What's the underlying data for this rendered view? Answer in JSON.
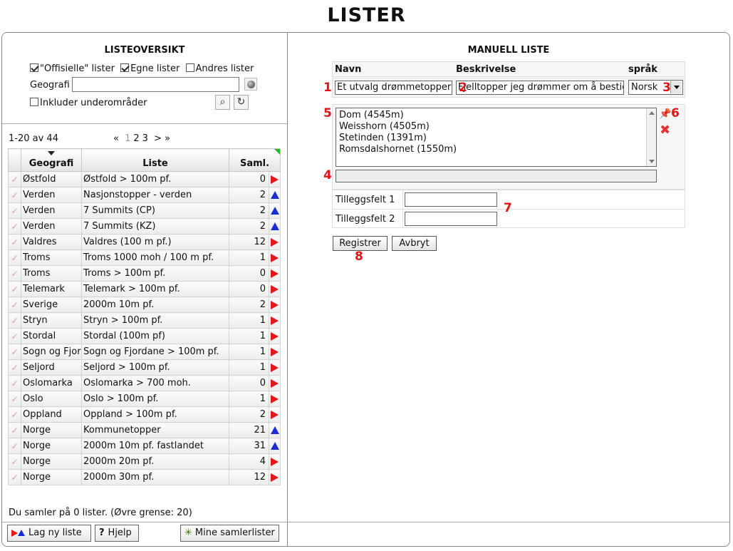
{
  "page": {
    "title": "LISTER"
  },
  "left": {
    "title": "LISTEOVERSIKT",
    "filters": {
      "offisielle": {
        "label": "\"Offisielle\" lister",
        "checked": true
      },
      "egne": {
        "label": "Egne lister",
        "checked": true
      },
      "andres": {
        "label": "Andres lister",
        "checked": false
      }
    },
    "geo_label": "Geografi",
    "geo_value": "",
    "include_label": "Inkluder underområder",
    "include_checked": false,
    "pager": {
      "range": "1-20 av 44",
      "first": "«",
      "p1": "1",
      "p2": "2",
      "p3": "3",
      "next": ">",
      "last": "»"
    },
    "columns": {
      "geo": "Geografi",
      "liste": "Liste",
      "saml": "Saml."
    },
    "rows": [
      {
        "geo": "Østfold",
        "liste": "Østfold > 100m pf.",
        "saml": "0",
        "ind": "right"
      },
      {
        "geo": "Verden",
        "liste": "Nasjonstopper - verden",
        "saml": "2",
        "ind": "up"
      },
      {
        "geo": "Verden",
        "liste": "7 Summits (CP)",
        "saml": "2",
        "ind": "up"
      },
      {
        "geo": "Verden",
        "liste": "7 Summits (KZ)",
        "saml": "2",
        "ind": "up"
      },
      {
        "geo": "Valdres",
        "liste": "Valdres (100 m pf.)",
        "saml": "12",
        "ind": "right"
      },
      {
        "geo": "Troms",
        "liste": "Troms 1000 moh / 100 m pf.",
        "saml": "1",
        "ind": "right"
      },
      {
        "geo": "Troms",
        "liste": "Troms > 100m pf.",
        "saml": "0",
        "ind": "right"
      },
      {
        "geo": "Telemark",
        "liste": "Telemark > 100m pf.",
        "saml": "0",
        "ind": "right"
      },
      {
        "geo": "Sverige",
        "liste": "2000m 10m pf.",
        "saml": "2",
        "ind": "right"
      },
      {
        "geo": "Stryn",
        "liste": "Stryn > 100m pf.",
        "saml": "1",
        "ind": "right"
      },
      {
        "geo": "Stordal",
        "liste": "Stordal (100m pf)",
        "saml": "1",
        "ind": "right"
      },
      {
        "geo": "Sogn og Fjordane",
        "liste": "Sogn og Fjordane > 100m pf.",
        "saml": "1",
        "ind": "right"
      },
      {
        "geo": "Seljord",
        "liste": "Seljord > 100m pf.",
        "saml": "1",
        "ind": "right"
      },
      {
        "geo": "Oslomarka",
        "liste": "Oslomarka > 700 moh.",
        "saml": "0",
        "ind": "right"
      },
      {
        "geo": "Oslo",
        "liste": "Oslo > 100m pf.",
        "saml": "1",
        "ind": "right"
      },
      {
        "geo": "Oppland",
        "liste": "Oppland > 100m pf.",
        "saml": "2",
        "ind": "right"
      },
      {
        "geo": "Norge",
        "liste": "Kommunetopper",
        "saml": "21",
        "ind": "up"
      },
      {
        "geo": "Norge",
        "liste": "2000m 10m pf. fastlandet",
        "saml": "31",
        "ind": "up"
      },
      {
        "geo": "Norge",
        "liste": "2000m 20m pf.",
        "saml": "4",
        "ind": "right"
      },
      {
        "geo": "Norge",
        "liste": "2000m 30m pf.",
        "saml": "12",
        "ind": "right"
      }
    ],
    "status": "Du samler på 0 lister. (Øvre grense: 20)",
    "buttons": {
      "new_list": "Lag ny liste",
      "help": "Hjelp",
      "my_lists": "Mine samlerlister"
    }
  },
  "right": {
    "title": "MANUELL LISTE",
    "col_navn": "Navn",
    "col_beskrivelse": "Beskrivelse",
    "col_sprak": "språk",
    "navn_value": "Et utvalg drømmetopper",
    "beskrivelse_value": "Fjelltopper jeg drømmer om å bestige",
    "sprak_value": "Norsk",
    "items": [
      "Dom (4545m)",
      "Weisshorn (4505m)",
      "Stetinden (1391m)",
      "Romsdalshornet (1550m)"
    ],
    "extra1_label": "Tilleggsfelt 1",
    "extra2_label": "Tilleggsfelt 2",
    "register_label": "Registrer",
    "cancel_label": "Avbryt",
    "markers": {
      "m1": "1",
      "m2": "2",
      "m3": "3",
      "m4": "4",
      "m5": "5",
      "m6": "6",
      "m7": "7",
      "m8": "8"
    }
  },
  "colors": {
    "indicator_red": "#e8161a",
    "indicator_blue": "#1a2ed8",
    "marker_red": "#e31414"
  }
}
